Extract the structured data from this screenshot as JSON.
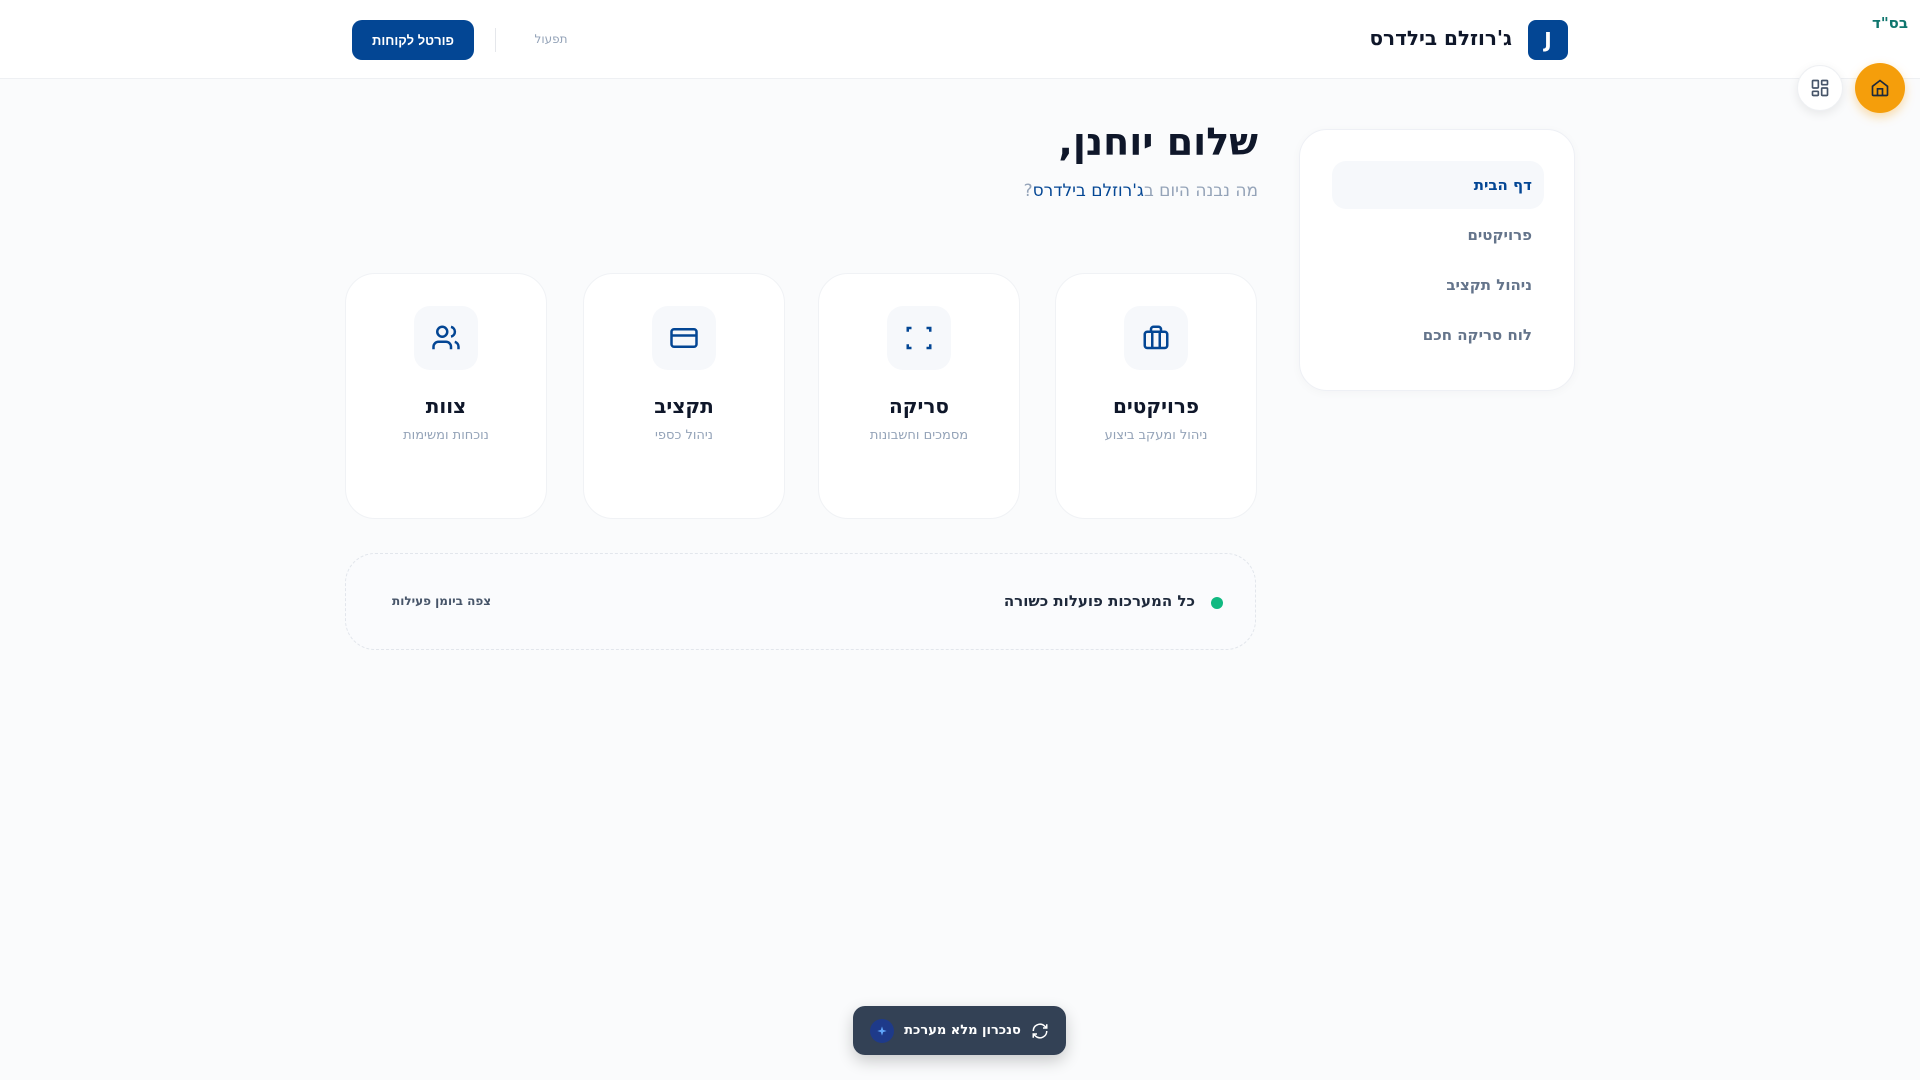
{
  "header": {
    "logo_letter": "J",
    "brand": "ג'רוזלם בילדרס",
    "operations": "תפעול",
    "portal_button": "פורטל לקוחות",
    "bsd": "בס\"ד"
  },
  "sidebar": {
    "items": [
      {
        "label": "דף הבית",
        "active": true
      },
      {
        "label": "פרויקטים"
      },
      {
        "label": "ניהול תקציב"
      },
      {
        "label": "לוח סריקה חכם"
      }
    ]
  },
  "main": {
    "title": "שלום יוחנן,",
    "subtitle_prefix": "מה נבנה היום ב",
    "subtitle_brand": "ג'רוזלם בילדרס",
    "subtitle_suffix": "?",
    "cards": [
      {
        "title": "פרויקטים",
        "subtitle": "ניהול ומעקב ביצוע",
        "icon": "briefcase-icon"
      },
      {
        "title": "סריקה",
        "subtitle": "מסמכים וחשבונות",
        "icon": "scan-icon"
      },
      {
        "title": "תקציב",
        "subtitle": "ניהול כספי",
        "icon": "credit-card-icon"
      },
      {
        "title": "צוות",
        "subtitle": "נוכחות ומשימות",
        "icon": "users-icon"
      }
    ],
    "status": {
      "text": "כל המערכות פועלות כשורה",
      "log_link": "צפה ביומן פעילות",
      "color": "#10b981"
    }
  },
  "sync_button": {
    "label": "סנכרון מלא מערכת"
  },
  "colors": {
    "brand": "#034694",
    "accent": "#f59e0b"
  }
}
